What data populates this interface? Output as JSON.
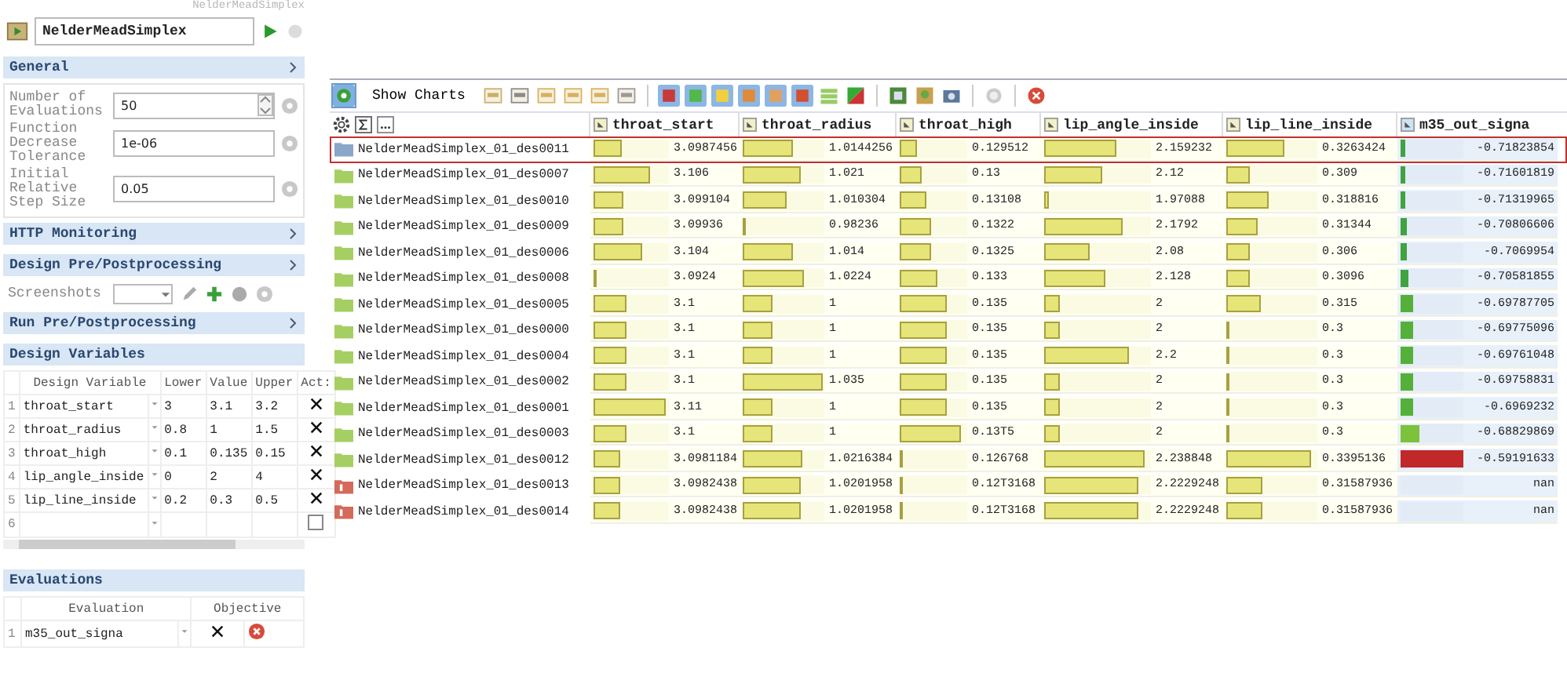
{
  "header": {
    "path": "NelderMeadSimplex",
    "algorithm": "NelderMeadSimplex"
  },
  "general": {
    "title": "General",
    "fields": [
      {
        "label": "Number of Evaluations",
        "value": "50",
        "kind": "spin"
      },
      {
        "label": "Function Decrease Tolerance",
        "value": "1e-06",
        "kind": "text"
      },
      {
        "label": "Initial Relative Step Size",
        "value": "0.05",
        "kind": "text"
      }
    ]
  },
  "http": {
    "title": "HTTP Monitoring"
  },
  "pre_post": {
    "title": "Design Pre/Postprocessing",
    "screenshots_label": "Screenshots"
  },
  "run_pre_post": {
    "title": "Run Pre/Postprocessing"
  },
  "design_variables": {
    "title": "Design Variables",
    "columns": [
      "Design Variable",
      "Lower",
      "Value",
      "Upper",
      "Act:"
    ],
    "rows": [
      {
        "index": "1",
        "name": "throat_start",
        "lower": "3",
        "value": "3.1",
        "upper": "3.2",
        "active": true
      },
      {
        "index": "2",
        "name": "throat_radius",
        "lower": "0.8",
        "value": "1",
        "upper": "1.5",
        "active": true
      },
      {
        "index": "3",
        "name": "throat_high",
        "lower": "0.1",
        "value": "0.135",
        "upper": "0.15",
        "active": true
      },
      {
        "index": "4",
        "name": "lip_angle_inside",
        "lower": "0",
        "value": "2",
        "upper": "4",
        "active": true
      },
      {
        "index": "5",
        "name": "lip_line_inside",
        "lower": "0.2",
        "value": "0.3",
        "upper": "0.5",
        "active": true
      },
      {
        "index": "6",
        "active": false
      }
    ]
  },
  "evaluations": {
    "title": "Evaluations",
    "columns": [
      "Evaluation",
      "Objective"
    ],
    "rows": [
      {
        "index": "1",
        "name": "m35_out_signa",
        "objective": true
      }
    ]
  },
  "toolbar": {
    "show_charts": "Show Charts"
  },
  "results": {
    "columns": [
      {
        "name": "throat_start",
        "kind": "param"
      },
      {
        "name": "throat_radius",
        "kind": "param"
      },
      {
        "name": "throat_high",
        "kind": "param"
      },
      {
        "name": "lip_angle_inside",
        "kind": "param"
      },
      {
        "name": "lip_line_inside",
        "kind": "param"
      },
      {
        "name": "m35_out_signa",
        "kind": "objective"
      }
    ],
    "rows": [
      {
        "name": "NelderMeadSimplex_01_des0011",
        "kind": "current",
        "selected": true,
        "cells": [
          {
            "value": "3.0987456",
            "level": 0.37
          },
          {
            "value": "1.0144256",
            "level": 0.62
          },
          {
            "value": "0.129512",
            "level": 0.26
          },
          {
            "value": "2.159232",
            "level": 0.67
          },
          {
            "value": "0.3263424",
            "level": 0.64
          },
          {
            "value": "-0.71823854",
            "level": 0.07,
            "color": "#3fa33f"
          }
        ]
      },
      {
        "name": "NelderMeadSimplex_01_des0007",
        "kind": "ok",
        "selected": false,
        "cells": [
          {
            "value": "3.106",
            "level": 0.75
          },
          {
            "value": "1.021",
            "level": 0.71
          },
          {
            "value": "0.13",
            "level": 0.33
          },
          {
            "value": "2.12",
            "level": 0.54
          },
          {
            "value": "0.309",
            "level": 0.25
          },
          {
            "value": "-0.71601819",
            "level": 0.07,
            "color": "#3fa33f"
          }
        ]
      },
      {
        "name": "NelderMeadSimplex_01_des0010",
        "kind": "ok",
        "selected": false,
        "cells": [
          {
            "value": "3.099104",
            "level": 0.39
          },
          {
            "value": "1.010304",
            "level": 0.53
          },
          {
            "value": "0.13108",
            "level": 0.4
          },
          {
            "value": "1.97088",
            "level": 0.04
          },
          {
            "value": "0.318816",
            "level": 0.47
          },
          {
            "value": "-0.71319965",
            "level": 0.08,
            "color": "#3fa33f"
          }
        ]
      },
      {
        "name": "NelderMeadSimplex_01_des0009",
        "kind": "ok",
        "selected": false,
        "cells": [
          {
            "value": "3.09936",
            "level": 0.4
          },
          {
            "value": "0.98236",
            "level": 0.04
          },
          {
            "value": "0.1322",
            "level": 0.47
          },
          {
            "value": "2.1792",
            "level": 0.73
          },
          {
            "value": "0.31344",
            "level": 0.34
          },
          {
            "value": "-0.70806606",
            "level": 0.1,
            "color": "#3fa33f"
          }
        ]
      },
      {
        "name": "NelderMeadSimplex_01_des0006",
        "kind": "ok",
        "selected": false,
        "cells": [
          {
            "value": "3.104",
            "level": 0.65
          },
          {
            "value": "1.014",
            "level": 0.62
          },
          {
            "value": "0.1325",
            "level": 0.47
          },
          {
            "value": "2.08",
            "level": 0.42
          },
          {
            "value": "0.306",
            "level": 0.25
          },
          {
            "value": "-0.7069954",
            "level": 0.1,
            "color": "#3fa33f"
          }
        ]
      },
      {
        "name": "NelderMeadSimplex_01_des0008",
        "kind": "ok",
        "selected": false,
        "cells": [
          {
            "value": "3.0924",
            "level": 0.04
          },
          {
            "value": "1.0224",
            "level": 0.75
          },
          {
            "value": "0.133",
            "level": 0.55
          },
          {
            "value": "2.128",
            "level": 0.57
          },
          {
            "value": "0.3096",
            "level": 0.25
          },
          {
            "value": "-0.70581855",
            "level": 0.12,
            "color": "#3fa33f"
          }
        ]
      },
      {
        "name": "NelderMeadSimplex_01_des0005",
        "kind": "ok",
        "selected": false,
        "cells": [
          {
            "value": "3.1",
            "level": 0.44
          },
          {
            "value": "1",
            "level": 0.36
          },
          {
            "value": "0.135",
            "level": 0.7
          },
          {
            "value": "2",
            "level": 0.14
          },
          {
            "value": "0.315",
            "level": 0.38
          },
          {
            "value": "-0.69787705",
            "level": 0.19,
            "color": "#55b03a"
          }
        ]
      },
      {
        "name": "NelderMeadSimplex_01_des0000",
        "kind": "ok",
        "selected": false,
        "cells": [
          {
            "value": "3.1",
            "level": 0.44
          },
          {
            "value": "1",
            "level": 0.36
          },
          {
            "value": "0.135",
            "level": 0.7
          },
          {
            "value": "2",
            "level": 0.14
          },
          {
            "value": "0.3",
            "level": 0.04
          },
          {
            "value": "-0.69775096",
            "level": 0.19,
            "color": "#55b03a"
          }
        ]
      },
      {
        "name": "NelderMeadSimplex_01_des0004",
        "kind": "ok",
        "selected": false,
        "cells": [
          {
            "value": "3.1",
            "level": 0.44
          },
          {
            "value": "1",
            "level": 0.36
          },
          {
            "value": "0.135",
            "level": 0.7
          },
          {
            "value": "2.2",
            "level": 0.8
          },
          {
            "value": "0.3",
            "level": 0.04
          },
          {
            "value": "-0.69761048",
            "level": 0.19,
            "color": "#55b03a"
          }
        ]
      },
      {
        "name": "NelderMeadSimplex_01_des0002",
        "kind": "ok",
        "selected": false,
        "cells": [
          {
            "value": "3.1",
            "level": 0.44
          },
          {
            "value": "1.035",
            "level": 0.98
          },
          {
            "value": "0.135",
            "level": 0.7
          },
          {
            "value": "2",
            "level": 0.14
          },
          {
            "value": "0.3",
            "level": 0.04
          },
          {
            "value": "-0.69758831",
            "level": 0.19,
            "color": "#55b03a"
          }
        ]
      },
      {
        "name": "NelderMeadSimplex_01_des0001",
        "kind": "ok",
        "selected": false,
        "cells": [
          {
            "value": "3.11",
            "level": 0.96
          },
          {
            "value": "1",
            "level": 0.36
          },
          {
            "value": "0.135",
            "level": 0.7
          },
          {
            "value": "2",
            "level": 0.14
          },
          {
            "value": "0.3",
            "level": 0.04
          },
          {
            "value": "-0.6969232",
            "level": 0.19,
            "color": "#55b03a"
          }
        ]
      },
      {
        "name": "NelderMeadSimplex_01_des0003",
        "kind": "ok",
        "selected": false,
        "cells": [
          {
            "value": "3.1",
            "level": 0.44
          },
          {
            "value": "1",
            "level": 0.36
          },
          {
            "value": "0.13T5",
            "level": 0.9
          },
          {
            "value": "2",
            "level": 0.14
          },
          {
            "value": "0.3",
            "level": 0.04
          },
          {
            "value": "-0.68829869",
            "level": 0.29,
            "color": "#7cc23a"
          }
        ]
      },
      {
        "name": "NelderMeadSimplex_01_des0012",
        "kind": "ok",
        "selected": false,
        "cells": [
          {
            "value": "3.0981184",
            "level": 0.35
          },
          {
            "value": "1.0216384",
            "level": 0.74
          },
          {
            "value": "0.126768",
            "level": 0.05
          },
          {
            "value": "2.238848",
            "level": 0.94
          },
          {
            "value": "0.3395136",
            "level": 0.93
          },
          {
            "value": "-0.59191633",
            "level": 1.0,
            "color": "#c0282a"
          }
        ]
      },
      {
        "name": "NelderMeadSimplex_01_des0013",
        "kind": "error",
        "selected": false,
        "cells": [
          {
            "value": "3.0982438",
            "level": 0.35
          },
          {
            "value": "1.0201958",
            "level": 0.71
          },
          {
            "value": "0.12T3168",
            "level": 0.05
          },
          {
            "value": "2.2229248",
            "level": 0.88
          },
          {
            "value": "0.31587936",
            "level": 0.4
          },
          {
            "value": "nan"
          }
        ]
      },
      {
        "name": "NelderMeadSimplex_01_des0014",
        "kind": "error",
        "selected": false,
        "cells": [
          {
            "value": "3.0982438",
            "level": 0.35
          },
          {
            "value": "1.0201958",
            "level": 0.71
          },
          {
            "value": "0.12T3168",
            "level": 0.05
          },
          {
            "value": "2.2229248",
            "level": 0.88
          },
          {
            "value": "0.31587936",
            "level": 0.4
          },
          {
            "value": "nan"
          }
        ]
      }
    ]
  }
}
